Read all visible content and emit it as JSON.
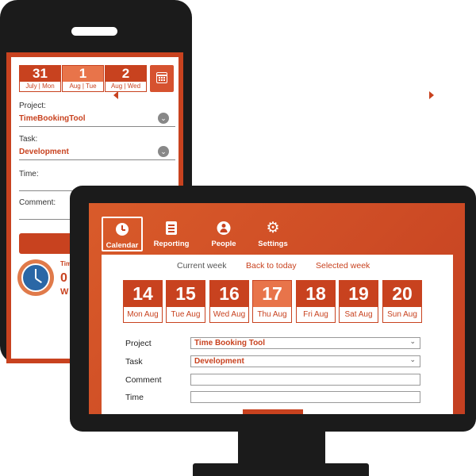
{
  "phone": {
    "dates": [
      {
        "day": "31",
        "label": "July | Mon"
      },
      {
        "day": "1",
        "label": "Aug | Tue"
      },
      {
        "day": "2",
        "label": "Aug | Wed"
      }
    ],
    "calendar_icon": "calendar-icon",
    "project_label": "Project:",
    "project_value": "TimeBookingTool",
    "task_label": "Task:",
    "task_value": "Development",
    "time_label": "Time:",
    "comment_label": "Comment:",
    "clipped_1": "Tim",
    "clipped_2": "0",
    "clipped_3": "W",
    "accent": "#c8421f"
  },
  "desktop": {
    "nav": [
      {
        "label": "Calendar",
        "icon": "clock-icon"
      },
      {
        "label": "Reporting",
        "icon": "document-icon"
      },
      {
        "label": "People",
        "icon": "person-icon"
      },
      {
        "label": "Settings",
        "icon": "gear-icon"
      }
    ],
    "week_tabs": {
      "current": "Current week",
      "back": "Back to today",
      "selected": "Selected week"
    },
    "dates": [
      {
        "day": "14",
        "label": "Mon Aug"
      },
      {
        "day": "15",
        "label": "Tue Aug"
      },
      {
        "day": "16",
        "label": "Wed Aug"
      },
      {
        "day": "17",
        "label": "Thu Aug"
      },
      {
        "day": "18",
        "label": "Fri Aug"
      },
      {
        "day": "19",
        "label": "Sat Aug"
      },
      {
        "day": "20",
        "label": "Sun Aug"
      }
    ],
    "form": {
      "project_label": "Project",
      "project_value": "Time Booking Tool",
      "task_label": "Task",
      "task_value": "Development",
      "comment_label": "Comment",
      "comment_value": "",
      "time_label": "Time",
      "time_value": ""
    },
    "accent": "#c8421f",
    "accent_light": "#e8744a"
  }
}
